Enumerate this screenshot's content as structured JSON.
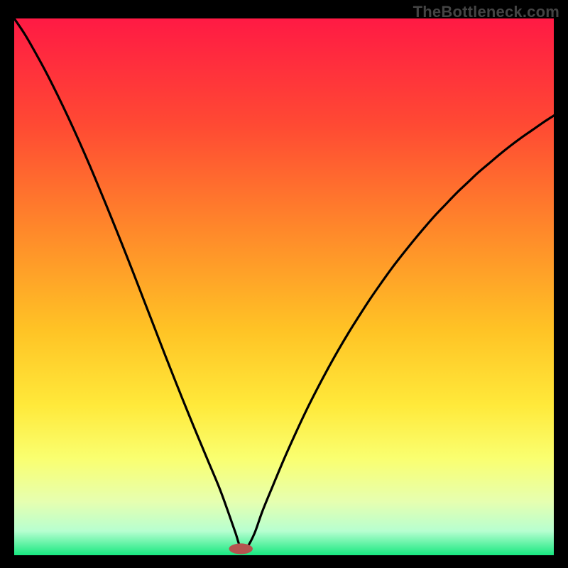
{
  "watermark": "TheBottleneck.com",
  "chart_data": {
    "type": "line",
    "title": "",
    "xlabel": "",
    "ylabel": "",
    "xlim": [
      0,
      100
    ],
    "ylim": [
      0,
      100
    ],
    "grid": false,
    "legend": false,
    "background_gradient": {
      "stops": [
        {
          "offset": 0.0,
          "color": "#ff1a44"
        },
        {
          "offset": 0.2,
          "color": "#ff4a33"
        },
        {
          "offset": 0.4,
          "color": "#ff8a2a"
        },
        {
          "offset": 0.58,
          "color": "#ffc325"
        },
        {
          "offset": 0.72,
          "color": "#ffe93a"
        },
        {
          "offset": 0.82,
          "color": "#faff70"
        },
        {
          "offset": 0.9,
          "color": "#e6ffb0"
        },
        {
          "offset": 0.955,
          "color": "#b7ffd0"
        },
        {
          "offset": 1.0,
          "color": "#17e880"
        }
      ]
    },
    "marker": {
      "x": 42,
      "y": 1.2,
      "rx": 2.2,
      "ry": 1.0,
      "color": "#b5534f"
    },
    "curve": {
      "description": "V-shaped bottleneck curve; minimum near x≈42, rising steeply on both sides",
      "x": [
        0,
        2,
        4,
        6,
        8,
        10,
        12,
        14,
        16,
        18,
        20,
        22,
        24,
        26,
        28,
        30,
        32,
        34,
        36,
        38,
        39.5,
        41,
        42,
        43,
        44.5,
        46,
        48,
        50,
        52,
        54,
        56,
        58,
        60,
        62,
        64,
        66,
        68,
        70,
        72,
        74,
        76,
        78,
        80,
        82,
        84,
        86,
        88,
        90,
        92,
        94,
        96,
        98,
        100
      ],
      "y": [
        100,
        97,
        93.5,
        89.8,
        85.8,
        81.6,
        77.2,
        72.6,
        67.8,
        62.9,
        57.9,
        52.8,
        47.6,
        42.4,
        37.2,
        32.1,
        27.1,
        22.2,
        17.4,
        12.6,
        8.5,
        4.2,
        1.3,
        1.3,
        4.0,
        8.2,
        13.1,
        17.9,
        22.4,
        26.7,
        30.7,
        34.5,
        38.1,
        41.5,
        44.7,
        47.8,
        50.7,
        53.5,
        56.1,
        58.6,
        61.0,
        63.3,
        65.4,
        67.5,
        69.4,
        71.3,
        73.0,
        74.7,
        76.3,
        77.8,
        79.2,
        80.6,
        81.9
      ]
    }
  }
}
